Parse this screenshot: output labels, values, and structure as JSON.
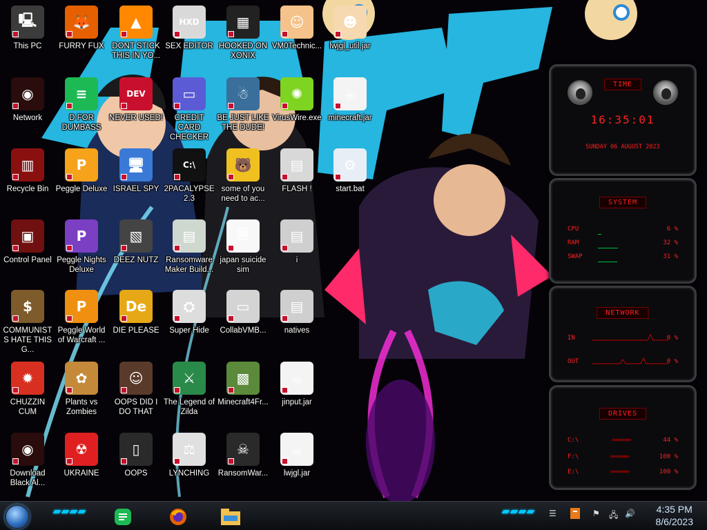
{
  "desktop": {
    "icons": [
      {
        "id": "this-pc",
        "label": "This PC",
        "col": 0,
        "row": 0,
        "bg": "#3b3b3b",
        "glyph": "🖳"
      },
      {
        "id": "furry-fux",
        "label": "FURRY FUX",
        "col": 1,
        "row": 0,
        "bg": "#e66000",
        "glyph": "🦊"
      },
      {
        "id": "dont-stick",
        "label": "DONT STICK THIS IN YO...",
        "col": 2,
        "row": 0,
        "bg": "#ff8800",
        "glyph": "▲"
      },
      {
        "id": "sex-editor",
        "label": "SEX EDITOR",
        "col": 3,
        "row": 0,
        "bg": "#d9d9d9",
        "glyph": "HXD"
      },
      {
        "id": "hooked-on-xonix",
        "label": "HOOKED ON XONIX",
        "col": 4,
        "row": 0,
        "bg": "#222",
        "glyph": "▦"
      },
      {
        "id": "vm0technic",
        "label": "VM0Technic...",
        "col": 5,
        "row": 0,
        "bg": "#f4c28a",
        "glyph": "☺"
      },
      {
        "id": "lwjgl-util",
        "label": "lwjgl_util.jar",
        "col": 6,
        "row": 0,
        "bg": "#f6d9b0",
        "glyph": "☻"
      },
      {
        "id": "network",
        "label": "Network",
        "col": 0,
        "row": 1,
        "bg": "#2a0c0c",
        "glyph": "◉"
      },
      {
        "id": "d-for-dumbass",
        "label": "D FOR DUMBASS",
        "col": 1,
        "row": 1,
        "bg": "#1db954",
        "glyph": "≡"
      },
      {
        "id": "never-used",
        "label": "NEVER USED!",
        "col": 2,
        "row": 1,
        "bg": "#c8102e",
        "glyph": "DEV"
      },
      {
        "id": "credit-card",
        "label": "CREDIT CARD CHECKER",
        "col": 3,
        "row": 1,
        "bg": "#5b5bd6",
        "glyph": "▭"
      },
      {
        "id": "be-just-like",
        "label": "BE JUST LIKE THE DUDE!",
        "col": 4,
        "row": 1,
        "bg": "#3a6f9c",
        "glyph": "☃"
      },
      {
        "id": "viruswire",
        "label": "VirusWire.exe",
        "col": 5,
        "row": 1,
        "bg": "#7fd321",
        "glyph": "✺"
      },
      {
        "id": "minecraft-jar",
        "label": "minecraft.jar",
        "col": 6,
        "row": 1,
        "bg": "#f4f4f4",
        "glyph": "☕"
      },
      {
        "id": "recycle-bin",
        "label": "Recycle Bin",
        "col": 0,
        "row": 2,
        "bg": "#8a1010",
        "glyph": "▥"
      },
      {
        "id": "peggle-deluxe",
        "label": "Peggle Deluxe",
        "col": 1,
        "row": 2,
        "bg": "#f6a21b",
        "glyph": "P"
      },
      {
        "id": "israel-spy",
        "label": "ISRAEL SPY",
        "col": 2,
        "row": 2,
        "bg": "#3a79d6",
        "glyph": "🖥"
      },
      {
        "id": "2pacalypse",
        "label": "2PACALYPSE 2.3",
        "col": 3,
        "row": 2,
        "bg": "#111",
        "glyph": "C:\\"
      },
      {
        "id": "some-of-you",
        "label": "some of you need to ac...",
        "col": 4,
        "row": 2,
        "bg": "#f0c020",
        "glyph": "🐻"
      },
      {
        "id": "flash",
        "label": "FLASH !",
        "col": 5,
        "row": 2,
        "bg": "#d8d8d8",
        "glyph": "▤"
      },
      {
        "id": "start-bat",
        "label": "start.bat",
        "col": 6,
        "row": 2,
        "bg": "#e8eef6",
        "glyph": "⚙"
      },
      {
        "id": "control-panel",
        "label": "Control Panel",
        "col": 0,
        "row": 3,
        "bg": "#701010",
        "glyph": "▣"
      },
      {
        "id": "peggle-nights",
        "label": "Peggle Nights Deluxe",
        "col": 1,
        "row": 3,
        "bg": "#7b3fc4",
        "glyph": "P"
      },
      {
        "id": "deez-nutz",
        "label": "DEEZ NUTZ",
        "col": 2,
        "row": 3,
        "bg": "#444",
        "glyph": "▧"
      },
      {
        "id": "ransomware-maker",
        "label": "Ransomware Maker Build...",
        "col": 3,
        "row": 3,
        "bg": "#cfd8cf",
        "glyph": "▤"
      },
      {
        "id": "japan-suicide",
        "label": "japan suicide sim",
        "col": 4,
        "row": 3,
        "bg": "#f8f8f8",
        "glyph": "🗎"
      },
      {
        "id": "folder-i",
        "label": "i",
        "col": 5,
        "row": 3,
        "bg": "#cfcfcf",
        "glyph": "▤"
      },
      {
        "id": "communists",
        "label": "COMMUNISTS HATE THIS G...",
        "col": 0,
        "row": 4,
        "bg": "#7d5b2a",
        "glyph": "$"
      },
      {
        "id": "peggle-world",
        "label": "Peggle World of Warcraft ...",
        "col": 1,
        "row": 4,
        "bg": "#f09010",
        "glyph": "P"
      },
      {
        "id": "die-please",
        "label": "DIE PLEASE",
        "col": 2,
        "row": 4,
        "bg": "#e6a817",
        "glyph": "De"
      },
      {
        "id": "super-hide",
        "label": "Super Hide",
        "col": 3,
        "row": 4,
        "bg": "#ddd",
        "glyph": "⛭"
      },
      {
        "id": "collabvmb",
        "label": "CollabVMB...",
        "col": 4,
        "row": 4,
        "bg": "#d4d4d4",
        "glyph": "▭"
      },
      {
        "id": "natives",
        "label": "natives",
        "col": 5,
        "row": 4,
        "bg": "#cfcfcf",
        "glyph": "▤"
      },
      {
        "id": "chuzzin-cum",
        "label": "CHUZZIN CUM",
        "col": 0,
        "row": 5,
        "bg": "#d83020",
        "glyph": "✹"
      },
      {
        "id": "plants-vs-zombies",
        "label": "Plants vs Zombies",
        "col": 1,
        "row": 5,
        "bg": "#c48a3a",
        "glyph": "✿"
      },
      {
        "id": "oops-did-i",
        "label": "OOPS DID I DO THAT",
        "col": 2,
        "row": 5,
        "bg": "#5a3a2a",
        "glyph": "☺"
      },
      {
        "id": "legend-of-zilda",
        "label": "The Legend of Zilda",
        "col": 3,
        "row": 5,
        "bg": "#2a8a4a",
        "glyph": "⚔"
      },
      {
        "id": "minecraft4fr",
        "label": "Minecraft4Fr...",
        "col": 4,
        "row": 5,
        "bg": "#5b8a3a",
        "glyph": "▩"
      },
      {
        "id": "jinput-jar",
        "label": "jinput.jar",
        "col": 5,
        "row": 5,
        "bg": "#f4f4f4",
        "glyph": "☕"
      },
      {
        "id": "download-black",
        "label": "Download Black Al...",
        "col": 0,
        "row": 6,
        "bg": "#2a0c0c",
        "glyph": "◉"
      },
      {
        "id": "ukraine",
        "label": "UKRAINE",
        "col": 1,
        "row": 6,
        "bg": "#e02020",
        "glyph": "☢"
      },
      {
        "id": "oops",
        "label": "OOPS",
        "col": 2,
        "row": 6,
        "bg": "#2a2a2a",
        "glyph": "▯"
      },
      {
        "id": "lynching",
        "label": "LYNCHING",
        "col": 3,
        "row": 6,
        "bg": "#e0e0e0",
        "glyph": "⚖"
      },
      {
        "id": "ransomwar",
        "label": "RansomWar...",
        "col": 4,
        "row": 6,
        "bg": "#2a2a2a",
        "glyph": "☠"
      },
      {
        "id": "lwjgl-jar",
        "label": "lwjgl.jar",
        "col": 5,
        "row": 6,
        "bg": "#f4f4f4",
        "glyph": "☕"
      }
    ]
  },
  "gadgets": {
    "time": {
      "title": "TIME",
      "clock": "16:35:01",
      "date": "SUNDAY 06 AUGUST 2023"
    },
    "system": {
      "title": "SYSTEM",
      "rows": [
        {
          "label": "CPU",
          "value": "6 %",
          "pct": 6
        },
        {
          "label": "RAM",
          "value": "32 %",
          "pct": 32
        },
        {
          "label": "SWAP",
          "value": "31 %",
          "pct": 31
        }
      ]
    },
    "network": {
      "title": "NETWORK",
      "rows": [
        {
          "label": "IN",
          "value": "0 %"
        },
        {
          "label": "OUT",
          "value": "0 %"
        }
      ]
    },
    "drives": {
      "title": "DRIVES",
      "rows": [
        {
          "label": "C:\\",
          "value": "44 %"
        },
        {
          "label": "F:\\",
          "value": "100 %"
        },
        {
          "label": "E:\\",
          "value": "100 %"
        }
      ]
    }
  },
  "taskbar": {
    "apps": [
      {
        "name": "notes-app",
        "color": "#1db954"
      },
      {
        "name": "firefox",
        "color": "#e66000"
      },
      {
        "name": "file-explorer",
        "color": "#f2c14e"
      }
    ],
    "clock": {
      "time": "4:35 PM",
      "date": "8/6/2023"
    }
  },
  "colors": {
    "accent": "#ff2020",
    "cyan": "#00c8ff",
    "pink": "#ff1493"
  }
}
